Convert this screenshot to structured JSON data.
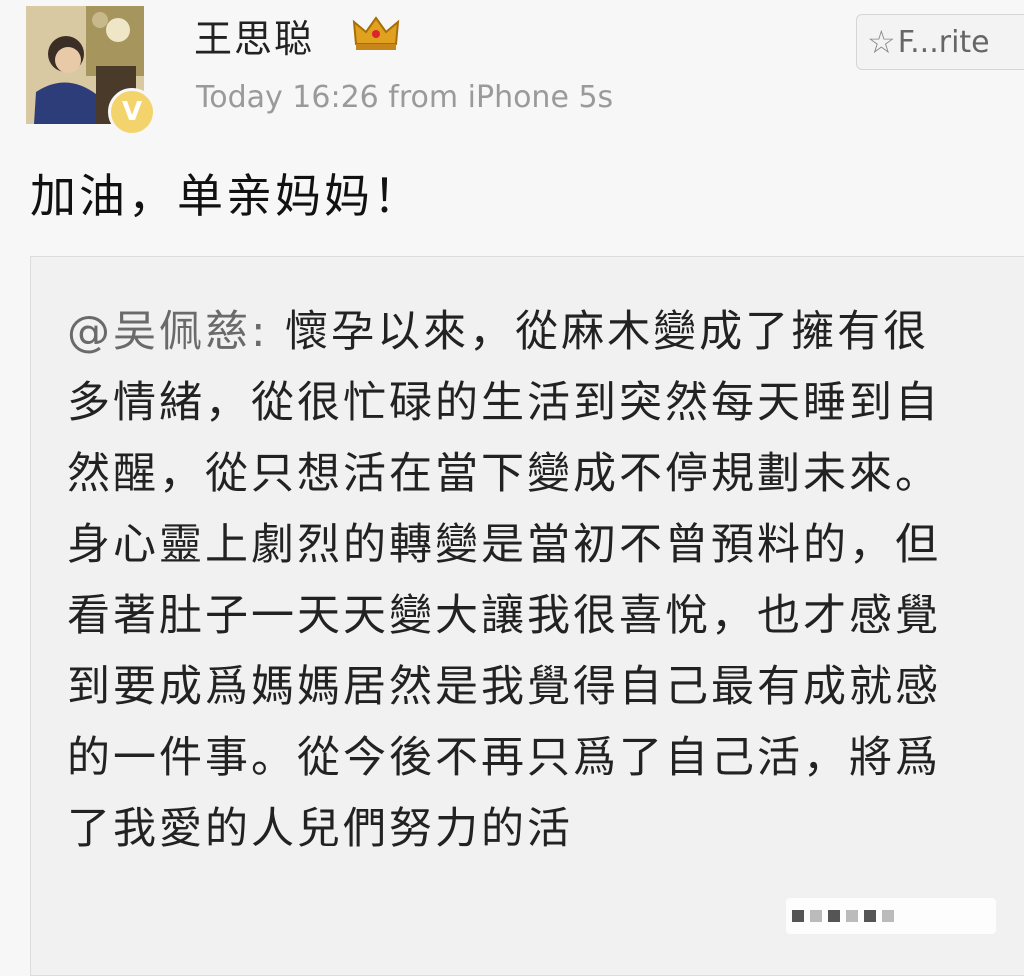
{
  "post": {
    "username": "王思聪",
    "meta": "Today 16:26  from iPhone 5s",
    "text": "加油，单亲妈妈！",
    "favorite_label": "F...rite",
    "badge_symbol": "V"
  },
  "repost": {
    "mention": "@吴佩慈:",
    "text": " 懷孕以來，從麻木變成了擁有很多情緒，從很忙碌的生活到突然每天睡到自然醒，從只想活在當下變成不停規劃未來。身心靈上劇烈的轉變是當初不曾預料的，但看著肚子一天天變大讓我很喜悅，也才感覺到要成爲媽媽居然是我覺得自己最有成就感的一件事。從今後不再只爲了自己活，將爲了我愛的人兒們努力的活"
  },
  "colors": {
    "background": "#f7f7f7",
    "repost_background": "#f1f1f1",
    "badge": "#f3d36b",
    "crown": "#e0a21e",
    "meta_text": "#9a9a9a"
  },
  "icons": {
    "verified": "verified-badge-icon",
    "crown": "crown-icon",
    "favorite": "star-icon"
  }
}
